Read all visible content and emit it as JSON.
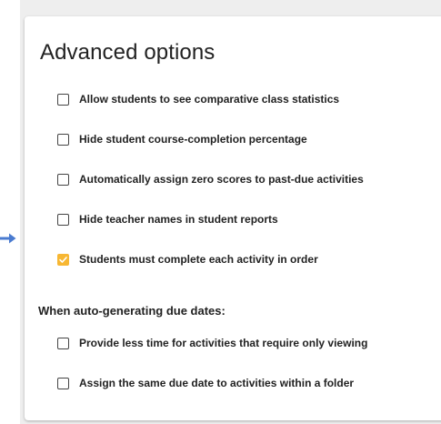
{
  "panel": {
    "title": "Advanced options"
  },
  "options": [
    {
      "label": "Allow students to see comparative class statistics",
      "checked": false
    },
    {
      "label": "Hide student course-completion percentage",
      "checked": false
    },
    {
      "label": "Automatically assign zero scores to past-due activities",
      "checked": false
    },
    {
      "label": "Hide teacher names in student reports",
      "checked": false
    },
    {
      "label": "Students must complete each activity in order",
      "checked": true
    }
  ],
  "due_dates": {
    "heading": "When auto-generating due dates:",
    "options": [
      {
        "label": "Provide less time for activities that require only viewing",
        "checked": false
      },
      {
        "label": "Assign the same due date to activities within a folder",
        "checked": false
      }
    ]
  },
  "colors": {
    "checkbox_checked": "#f7b733",
    "pointer_arrow": "#4a7bd0"
  },
  "icons": {
    "pointer": "arrow-right-icon",
    "check": "checkmark-icon"
  }
}
